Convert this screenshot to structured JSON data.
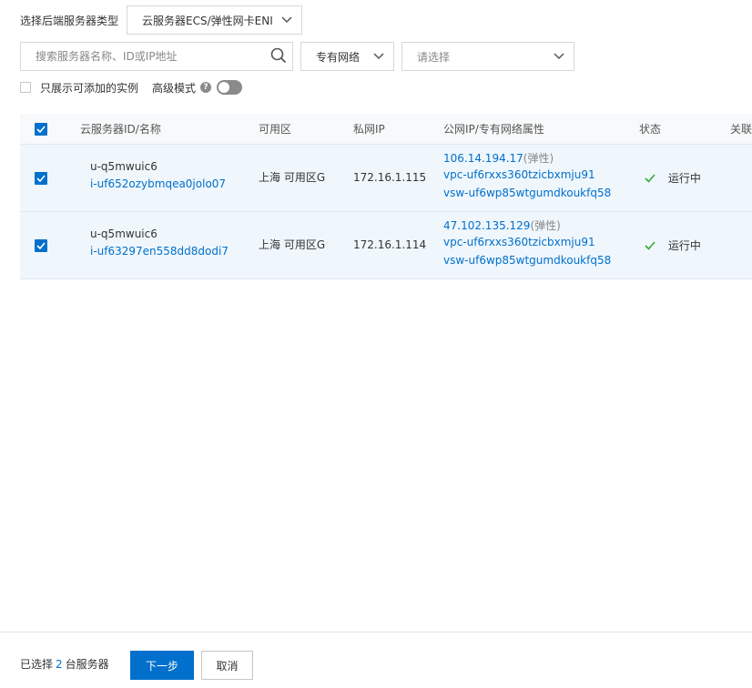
{
  "filters": {
    "server_type_label": "选择后端服务器类型",
    "server_type_value": "云服务器ECS/弹性网卡ENI",
    "search_placeholder": "搜索服务器名称、ID或IP地址",
    "network_type_value": "专有网络",
    "vpc_placeholder": "请选择",
    "only_addable_label": "只展示可添加的实例",
    "advanced_mode_label": "高级模式",
    "help_icon_text": "?"
  },
  "table": {
    "columns": [
      "云服务器ID/名称",
      "可用区",
      "私网IP",
      "公网IP/专有网络属性",
      "状态",
      "关联"
    ],
    "rows": [
      {
        "name": "u-q5mwuic6",
        "id": "i-uf652ozybmqea0jolo07",
        "zone": "上海 可用区G",
        "private_ip": "172.16.1.115",
        "public_ip": "106.14.194.17",
        "public_ip_tag": "(弹性)",
        "vpc": "vpc-uf6rxxs360tzicbxmju91",
        "vswitch": "vsw-uf6wp85wtgumdkoukfq58",
        "status": "运行中"
      },
      {
        "name": "u-q5mwuic6",
        "id": "i-uf63297en558dd8dodi7",
        "zone": "上海 可用区G",
        "private_ip": "172.16.1.114",
        "public_ip": "47.102.135.129",
        "public_ip_tag": "(弹性)",
        "vpc": "vpc-uf6rxxs360tzicbxmju91",
        "vswitch": "vsw-uf6wp85wtgumdkoukfq58",
        "status": "运行中"
      }
    ]
  },
  "footer": {
    "selected_prefix": "已选择",
    "selected_count": "2",
    "selected_suffix": "台服务器",
    "next_label": "下一步",
    "cancel_label": "取消"
  },
  "colors": {
    "accent": "#0070cc",
    "success": "#35a835",
    "row_selected_bg": "#eff6fc"
  },
  "icons": [
    "chevron-down-icon",
    "search-icon",
    "help-icon",
    "toggle-switch",
    "checkbox-checked-icon",
    "check-icon"
  ]
}
